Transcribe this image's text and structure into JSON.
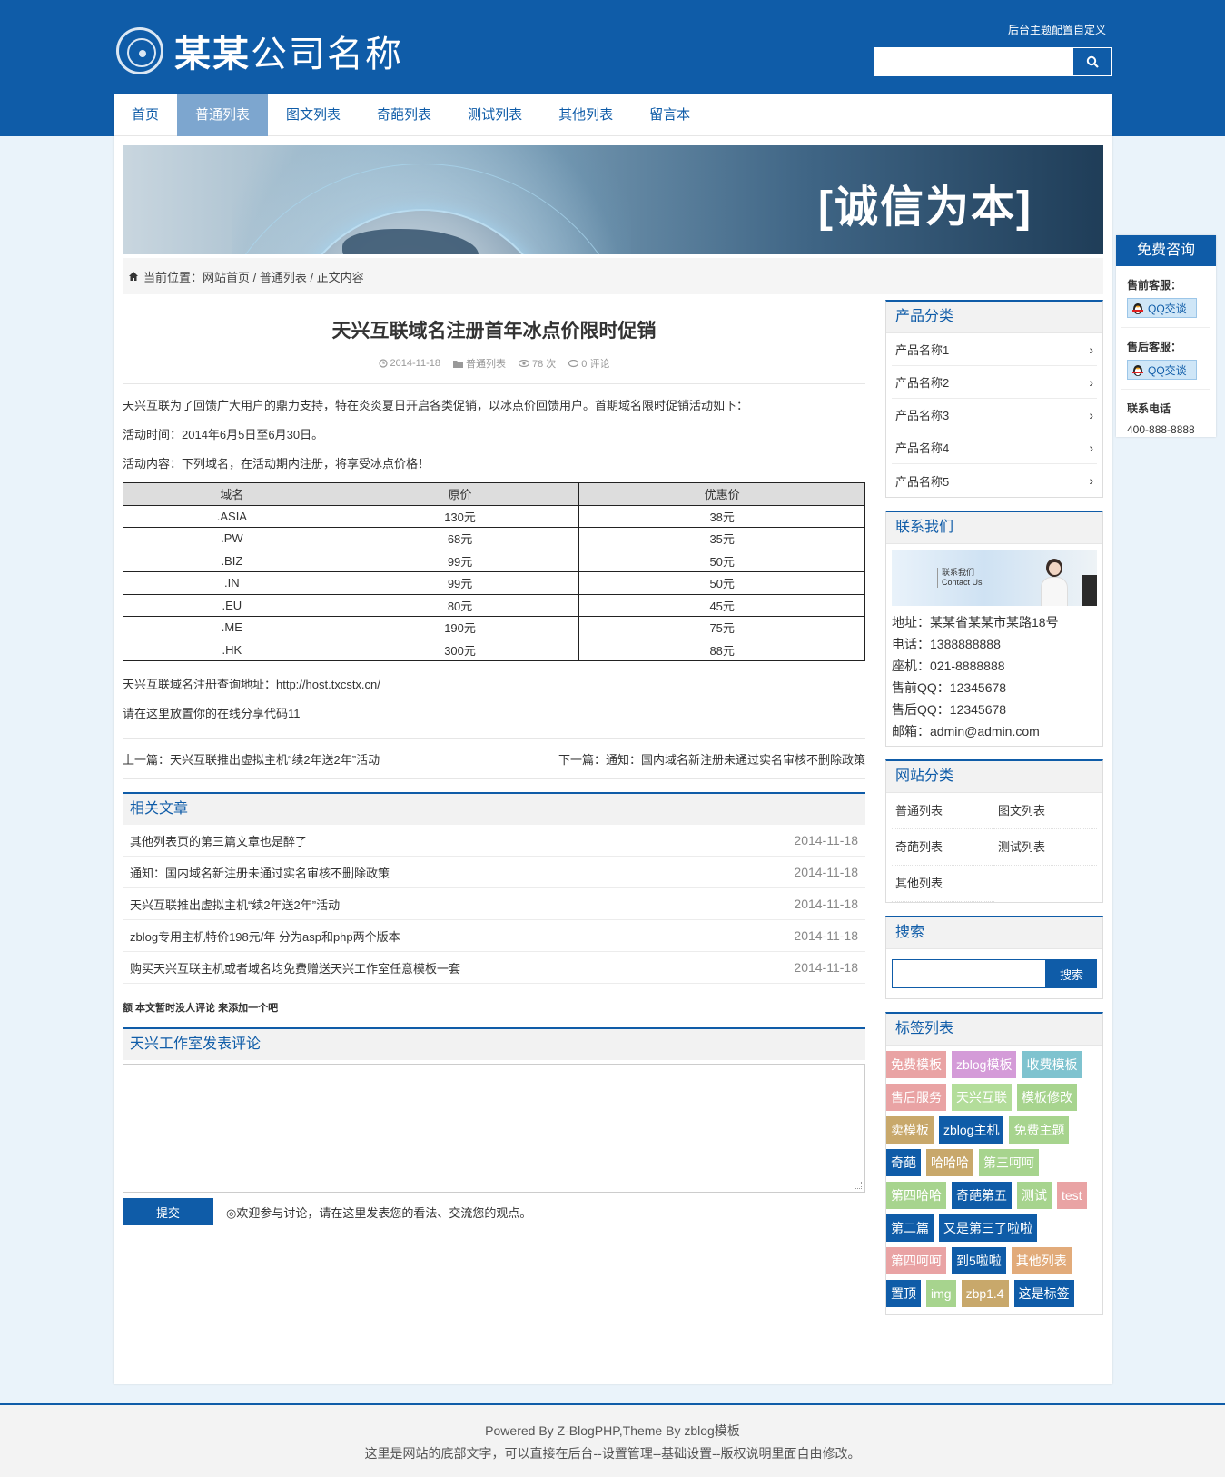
{
  "header": {
    "brand_bold": "某某",
    "brand_rest": "公司名称",
    "top_link": "后台主题配置自定义",
    "search_placeholder": ""
  },
  "nav": [
    "首页",
    "普通列表",
    "图文列表",
    "奇葩列表",
    "测试列表",
    "其他列表",
    "留言本"
  ],
  "nav_active_index": 1,
  "banner": {
    "slogan": "[诚信为本]"
  },
  "breadcrumb": "当前位置：网站首页 / 普通列表 / 正文内容",
  "article": {
    "title": "天兴互联域名注册首年冰点价限时促销",
    "meta": {
      "date": "2014-11-18",
      "category": "普通列表",
      "views": "78 次",
      "comments": "0 评论"
    },
    "paragraphs": [
      "天兴互联为了回馈广大用户的鼎力支持，特在炎炎夏日开启各类促销，以冰点价回馈用户。首期域名限时促销活动如下：",
      "活动时间：2014年6月5日至6月30日。",
      "活动内容：下列域名，在活动期内注册，将享受冰点价格！"
    ],
    "table": {
      "headers": [
        "域名",
        "原价",
        "优惠价"
      ],
      "rows": [
        [
          ".ASIA",
          "130元",
          "38元"
        ],
        [
          ".PW",
          "68元",
          "35元"
        ],
        [
          ".BIZ",
          "99元",
          "50元"
        ],
        [
          ".IN",
          "99元",
          "50元"
        ],
        [
          ".EU",
          "80元",
          "45元"
        ],
        [
          ".ME",
          "190元",
          "75元"
        ],
        [
          ".HK",
          "300元",
          "88元"
        ]
      ]
    },
    "after_table": [
      "天兴互联域名注册查询地址：http://host.txcstx.cn/",
      "请在这里放置你的在线分享代码11"
    ],
    "prev": "上一篇：天兴互联推出虚拟主机“续2年送2年”活动",
    "next": "下一篇：通知：国内域名新注册未通过实名审核不删除政策"
  },
  "related": {
    "title": "相关文章",
    "items": [
      {
        "title": "其他列表页的第三篇文章也是醉了",
        "date": "2014-11-18"
      },
      {
        "title": "通知：国内域名新注册未通过实名审核不删除政策",
        "date": "2014-11-18"
      },
      {
        "title": "天兴互联推出虚拟主机“续2年送2年”活动",
        "date": "2014-11-18"
      },
      {
        "title": "zblog专用主机特价198元/年 分为asp和php两个版本",
        "date": "2014-11-18"
      },
      {
        "title": "购买天兴互联主机或者域名均免费赠送天兴工作室任意模板一套",
        "date": "2014-11-18"
      }
    ]
  },
  "comments": {
    "none_text": "额 本文暂时没人评论 来添加一个吧",
    "form_title": "天兴工作室发表评论",
    "submit": "提交",
    "tip": "◎欢迎参与讨论，请在这里发表您的看法、交流您的观点。"
  },
  "sidebar": {
    "products": {
      "title": "产品分类",
      "items": [
        "产品名称1",
        "产品名称2",
        "产品名称3",
        "产品名称4",
        "产品名称5"
      ]
    },
    "contact": {
      "title": "联系我们",
      "img_text_1": "联系我们",
      "img_text_2": "Contact Us",
      "lines": [
        "地址：某某省某某市某路18号",
        "电话：1388888888",
        "座机：021-8888888",
        "售前QQ：12345678",
        "售后QQ：12345678",
        "邮箱：admin@admin.com"
      ]
    },
    "categories": {
      "title": "网站分类",
      "items": [
        "普通列表",
        "图文列表",
        "奇葩列表",
        "测试列表",
        "其他列表"
      ]
    },
    "search": {
      "title": "搜索",
      "button": "搜索"
    },
    "tags": {
      "title": "标签列表",
      "items": [
        {
          "label": "免费模板",
          "color": "#e9a3a4"
        },
        {
          "label": "zblog模板",
          "color": "#d49bd8"
        },
        {
          "label": "收费模板",
          "color": "#7fc3cf"
        },
        {
          "label": "售后服务",
          "color": "#e9a3a4"
        },
        {
          "label": "天兴互联",
          "color": "#b3dd9a"
        },
        {
          "label": "模板修改",
          "color": "#a7d48e"
        },
        {
          "label": "卖模板",
          "color": "#c8a86b"
        },
        {
          "label": "zblog主机",
          "color": "#0f5ca8"
        },
        {
          "label": "免费主题",
          "color": "#a7d48e"
        },
        {
          "label": "奇葩",
          "color": "#0f5ca8"
        },
        {
          "label": "哈哈哈",
          "color": "#c8a86b"
        },
        {
          "label": "第三呵呵",
          "color": "#a7d48e"
        },
        {
          "label": "第四哈哈",
          "color": "#a7d48e"
        },
        {
          "label": "奇葩第五",
          "color": "#0f5ca8"
        },
        {
          "label": "测试",
          "color": "#a7d48e"
        },
        {
          "label": "test",
          "color": "#e9a3a4"
        },
        {
          "label": "第二篇",
          "color": "#0f5ca8"
        },
        {
          "label": "又是第三了啦啦",
          "color": "#0f5ca8"
        },
        {
          "label": "第四呵呵",
          "color": "#e9a3a4"
        },
        {
          "label": "到5啦啦",
          "color": "#0f5ca8"
        },
        {
          "label": "其他列表",
          "color": "#e2ab7a"
        },
        {
          "label": "置顶",
          "color": "#0f5ca8"
        },
        {
          "label": "img",
          "color": "#a7d48e"
        },
        {
          "label": "zbp1.4",
          "color": "#c8a86b"
        },
        {
          "label": "这是标签",
          "color": "#0f5ca8"
        }
      ]
    }
  },
  "float_panel": {
    "title": "免费咨询",
    "presale_label": "售前客服：",
    "aftersale_label": "售后客服：",
    "qq_button": "QQ交谈",
    "phone_label": "联系电话",
    "phone": "400-888-8888"
  },
  "footer": {
    "line1": "Powered By Z-BlogPHP,Theme By zblog模板",
    "line2": "这里是网站的底部文字，可以直接在后台--设置管理--基础设置--版权说明里面自由修改。"
  },
  "colors": {
    "primary": "#0f5ca8",
    "nav_active": "#7da6cf",
    "page_bg": "#eaf3fa"
  }
}
